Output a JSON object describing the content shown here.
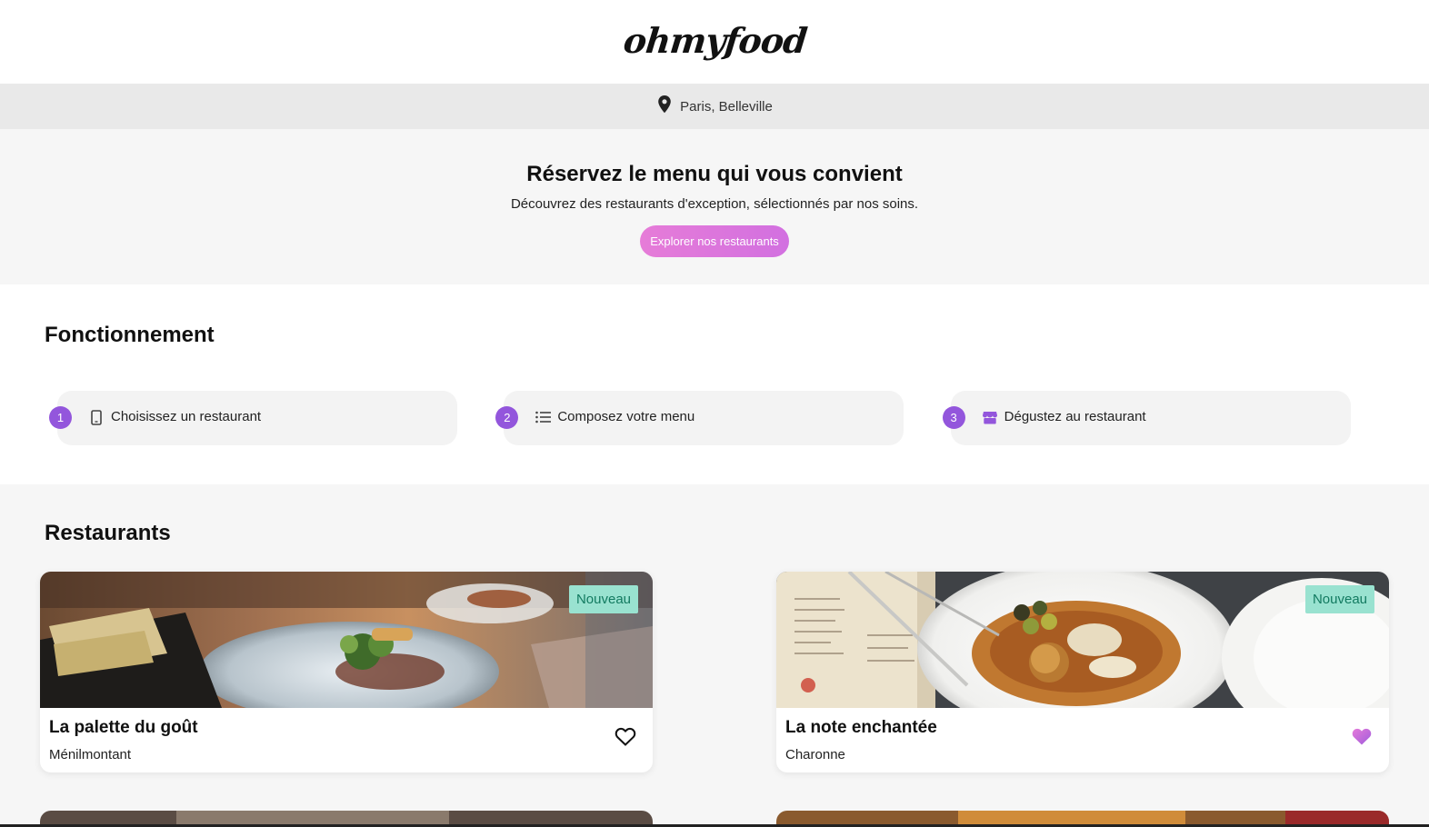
{
  "header": {
    "logo": "ohmyfood"
  },
  "location": {
    "icon": "map-pin-icon",
    "text": "Paris, Belleville"
  },
  "hero": {
    "title": "Réservez le menu qui vous convient",
    "subtitle": "Découvrez des restaurants d'exception, sélectionnés par nos soins.",
    "cta_label": "Explorer nos restaurants"
  },
  "how": {
    "title": "Fonctionnement",
    "steps": [
      {
        "number": "1",
        "icon": "smartphone-icon",
        "label": "Choisissez un restaurant"
      },
      {
        "number": "2",
        "icon": "list-icon",
        "label": "Composez votre menu"
      },
      {
        "number": "3",
        "icon": "store-icon",
        "label": "Dégustez au restaurant"
      }
    ]
  },
  "restaurants": {
    "title": "Restaurants",
    "items": [
      {
        "name": "La palette du goût",
        "district": "Ménilmontant",
        "badge": "Nouveau",
        "liked": false
      },
      {
        "name": "La note enchantée",
        "district": "Charonne",
        "badge": "Nouveau",
        "liked": true
      }
    ]
  },
  "colors": {
    "accent_purple": "#9356dc",
    "cta_pink": "#e67cd8",
    "badge_green": "#99e2d0",
    "heart_liked": "#b86be0"
  }
}
